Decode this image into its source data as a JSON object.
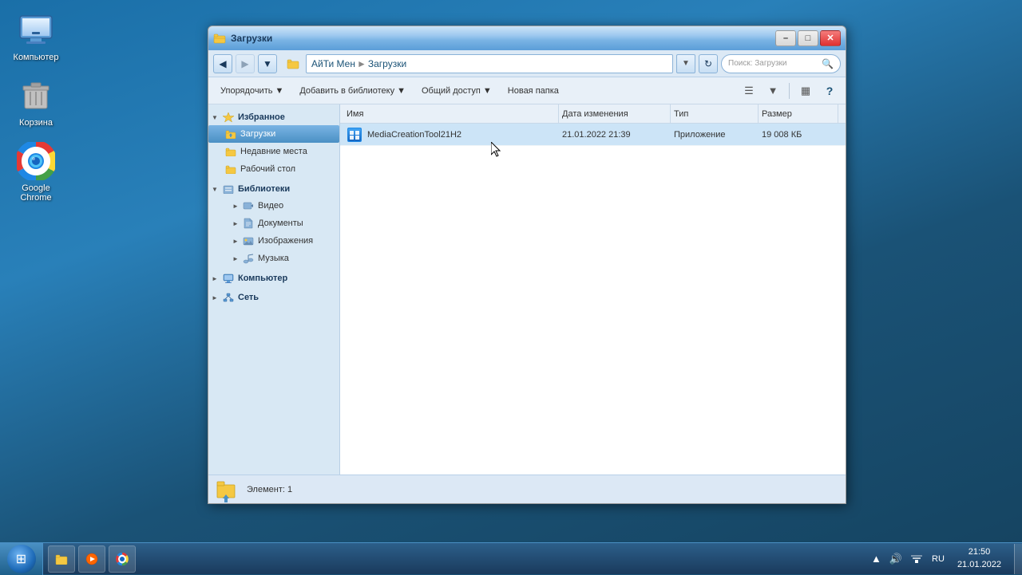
{
  "desktop": {
    "icons": [
      {
        "id": "computer",
        "label": "Компьютер",
        "type": "computer"
      },
      {
        "id": "recycle",
        "label": "Корзина",
        "type": "recycle"
      },
      {
        "id": "chrome",
        "label": "Google Chrome",
        "type": "chrome"
      }
    ]
  },
  "explorer": {
    "title": "Загрузки",
    "path": {
      "root": "АйТи Мен",
      "current": "Загрузки"
    },
    "toolbar": {
      "organize": "Упорядочить",
      "add_to_library": "Добавить в библиотеку",
      "share": "Общий доступ",
      "new_folder": "Новая папка"
    },
    "search_placeholder": "Поиск: Загрузки",
    "columns": {
      "name": "Имя",
      "date": "Дата изменения",
      "type": "Тип",
      "size": "Размер"
    },
    "files": [
      {
        "name": "MediaCreationTool21H2",
        "date": "21.01.2022 21:39",
        "type": "Приложение",
        "size": "19 008 КБ",
        "selected": true
      }
    ],
    "sidebar": {
      "favorites": {
        "label": "Избранное",
        "items": [
          {
            "id": "downloads",
            "label": "Загрузки",
            "selected": true
          },
          {
            "id": "recent",
            "label": "Недавние места",
            "selected": false
          },
          {
            "id": "desktop",
            "label": "Рабочий стол",
            "selected": false
          }
        ]
      },
      "libraries": {
        "label": "Библиотеки",
        "items": [
          {
            "id": "video",
            "label": "Видео"
          },
          {
            "id": "docs",
            "label": "Документы"
          },
          {
            "id": "images",
            "label": "Изображения"
          },
          {
            "id": "music",
            "label": "Музыка"
          }
        ]
      },
      "computer": {
        "label": "Компьютер"
      },
      "network": {
        "label": "Сеть"
      }
    },
    "status": {
      "text": "Элемент: 1"
    }
  },
  "taskbar": {
    "items": [
      {
        "id": "explorer",
        "label": "Проводник",
        "type": "explorer"
      },
      {
        "id": "media",
        "label": "Медиаплеер",
        "type": "media"
      },
      {
        "id": "chrome",
        "label": "Google Chrome",
        "type": "chrome"
      }
    ],
    "tray": {
      "lang": "RU",
      "time": "21:50",
      "date": "21.01.2022"
    }
  }
}
